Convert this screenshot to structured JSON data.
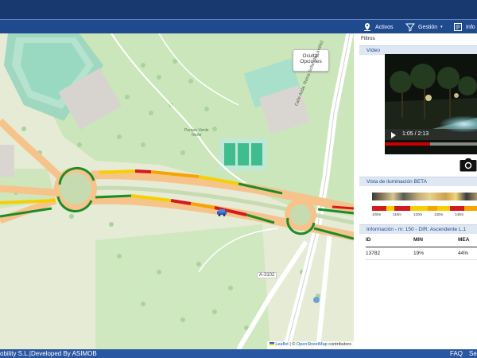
{
  "nav": {
    "activos": "Activos",
    "gestion": "Gestión",
    "info": "Info"
  },
  "map": {
    "hide_options_line1": "Ocultar",
    "hide_options_line2": "Opciones",
    "road_shield": "A-3102",
    "road_name": "Calle Avda. Reina Sofia (de Lavalle)",
    "park_name_line1": "Parque Verde",
    "park_name_line2": "Norte",
    "attribution_leaflet": "Leaflet",
    "attribution_sep": " | © ",
    "attribution_osm": "OpenStreetMap",
    "attribution_tail": " contributors",
    "colors": {
      "land": "#e8ecd9",
      "park": "#c9e4b8",
      "road_main": "#f6c48b",
      "lum_good": "#1c8c2a",
      "lum_mid": "#f5d000",
      "lum_bad": "#d41a1a"
    }
  },
  "panel": {
    "filters": "Filtros",
    "video_header": "Vídeo",
    "video_time": "1:05 / 2:13",
    "video_progress": 0.49,
    "lighting_header": "Vista de iluminación  BETA",
    "lum_ticks": [
      "100m",
      "110m",
      "120m",
      "130m",
      "140m"
    ],
    "info_header": "Información - m: 150 - DIR: Ascendente L.1",
    "table": {
      "headers": [
        "ID",
        "MIN",
        "MEA"
      ],
      "rows": [
        [
          "13782",
          "19%",
          "44%"
        ]
      ]
    }
  },
  "footer": {
    "left": "obility S.L.|Developed By ASIMOB",
    "faq": "FAQ",
    "se": "Se"
  }
}
